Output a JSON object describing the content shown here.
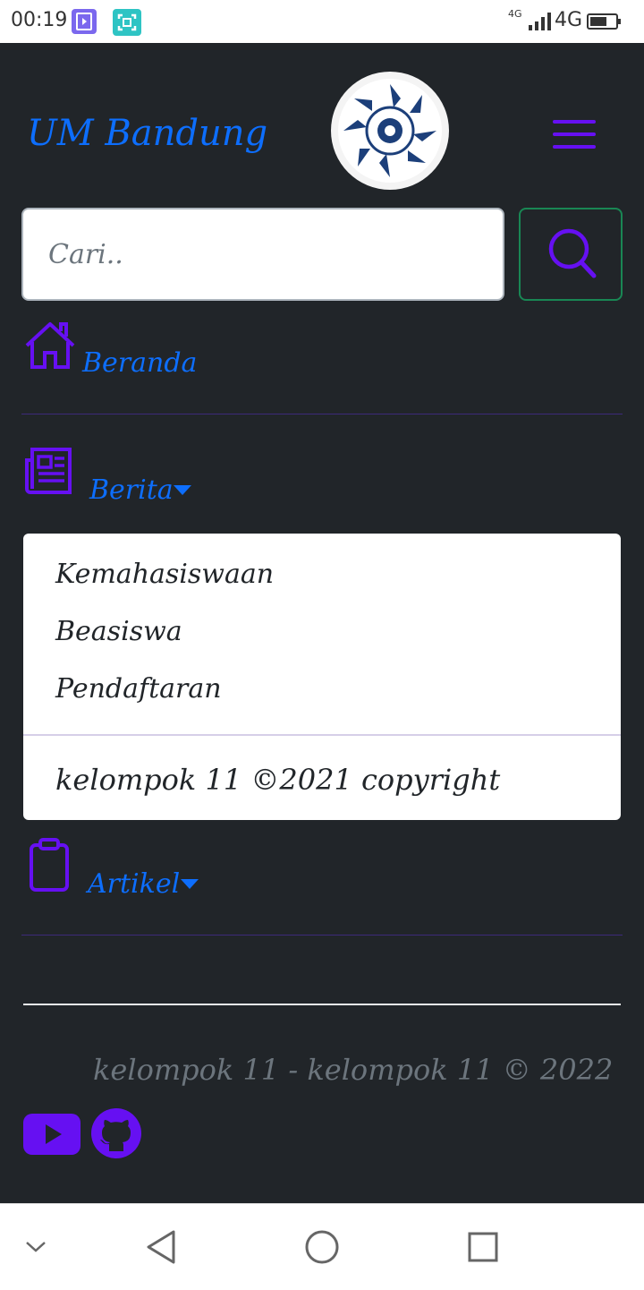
{
  "status_bar": {
    "time": "00:19",
    "network_small": "4G",
    "network_label": "4G"
  },
  "header": {
    "brand": "UM Bandung",
    "logo_icon": "university-logo",
    "menu_icon": "hamburger-icon"
  },
  "search": {
    "placeholder": "Cari..",
    "button_icon": "search-icon"
  },
  "nav": {
    "items": [
      {
        "label": "Beranda",
        "icon": "house-icon"
      },
      {
        "label": "Berita",
        "icon": "newspaper-icon"
      },
      {
        "label": "Artikel",
        "icon": "clipboard-icon"
      }
    ]
  },
  "dropdown": {
    "items": [
      "Kemahasiswaan",
      "Beasiswa",
      "Pendaftaran"
    ],
    "footer": "kelompok 11 ©2021 copyright"
  },
  "footer": {
    "text": "kelompok 11 - kelompok 11 © 2022",
    "social": [
      "youtube-icon",
      "github-icon"
    ]
  },
  "colors": {
    "background": "#212529",
    "brand": "#0d6efd",
    "accent_purple": "#6610f2",
    "search_border": "#198754"
  }
}
